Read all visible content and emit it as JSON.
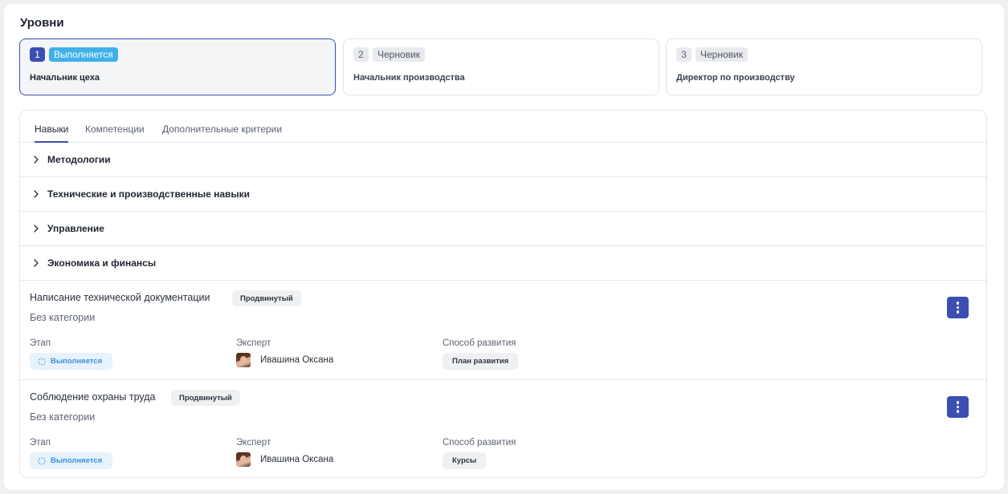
{
  "title": "Уровни",
  "levels": [
    {
      "num": "1",
      "status": "Выполняется",
      "name": "Начальник цеха"
    },
    {
      "num": "2",
      "status": "Черновик",
      "name": "Начальник производства"
    },
    {
      "num": "3",
      "status": "Черновик",
      "name": "Директор по производству"
    }
  ],
  "tabs": [
    "Навыки",
    "Компетенции",
    "Дополнительные критерии"
  ],
  "groups": [
    "Методологии",
    "Технические и производственные навыки",
    "Управление",
    "Экономика и финансы"
  ],
  "field_labels": {
    "stage": "Этап",
    "expert": "Эксперт",
    "method": "Способ развития"
  },
  "skills": [
    {
      "name": "Написание технической документации",
      "level": "Продвинутый",
      "category": "Без категории",
      "stage": "Выполняется",
      "expert": "Ивашина Оксана",
      "method": "План развития"
    },
    {
      "name": "Соблюдение охраны труда",
      "level": "Продвинутый",
      "category": "Без категории",
      "stage": "Выполняется",
      "expert": "Ивашина Оксана",
      "method": "Курсы"
    }
  ],
  "colors": {
    "accent": "#3a4fb0",
    "status_active": "#3fb0ea",
    "stage_text": "#3a8fd9"
  },
  "icons": {
    "group_toggle": "chevron-right-icon",
    "menu": "more-vertical-icon",
    "stage": "spinner-icon"
  }
}
